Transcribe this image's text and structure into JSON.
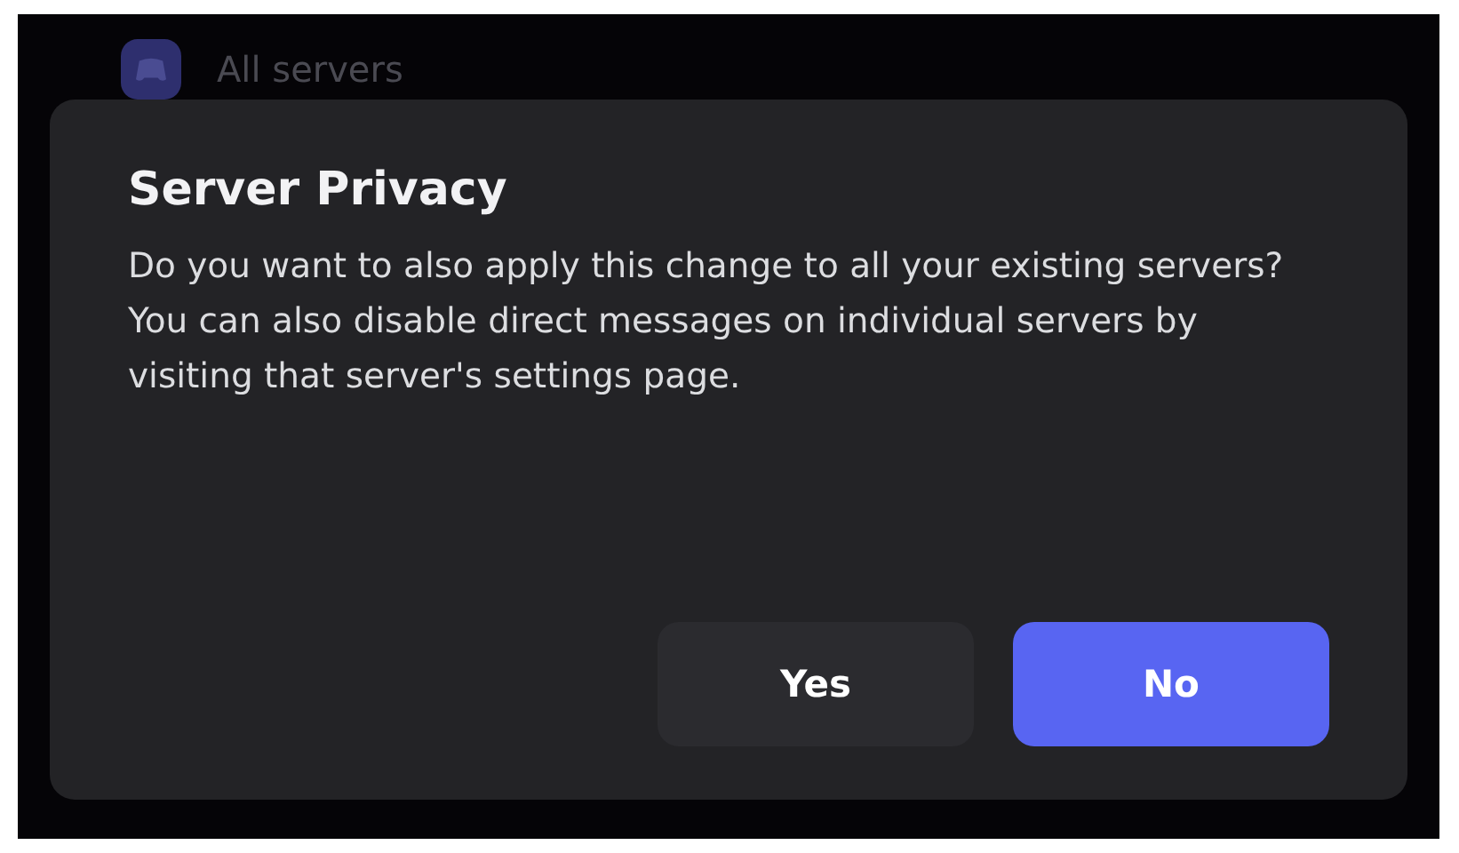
{
  "background": {
    "label": "All servers"
  },
  "dialog": {
    "title": "Server Privacy",
    "message": "Do you want to also apply this change to all your existing servers? You can also disable direct messages on individual servers by visiting that server's settings page.",
    "buttons": [
      {
        "label": "Yes",
        "kind": "secondary"
      },
      {
        "label": "No",
        "kind": "primary"
      }
    ]
  }
}
